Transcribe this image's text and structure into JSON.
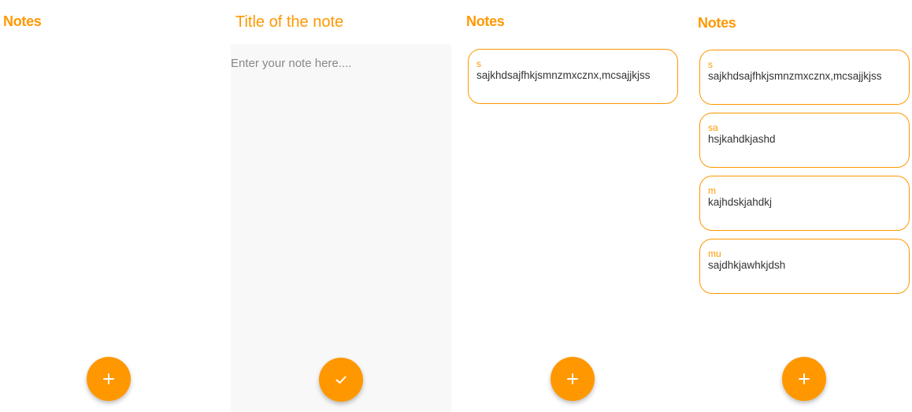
{
  "colors": {
    "accent": "#ff9800",
    "editor_bg": "#f8f8f8"
  },
  "screen1": {
    "heading": "Notes",
    "fab_icon": "plus-icon"
  },
  "screen2": {
    "title_placeholder": "Title of the note",
    "body_placeholder": "Enter your note here....",
    "fab_icon": "check-icon"
  },
  "screen3": {
    "heading": "Notes",
    "notes": [
      {
        "title": "s",
        "text": "sajkhdsajfhkjsmnzmxcznx,mcsajjkjss"
      }
    ],
    "fab_icon": "plus-icon"
  },
  "screen4": {
    "heading": "Notes",
    "notes": [
      {
        "title": "s",
        "text": "sajkhdsajfhkjsmnzmxcznx,mcsajjkjss"
      },
      {
        "title": "sa",
        "text": "hsjkahdkjashd"
      },
      {
        "title": "m",
        "text": "kajhdskjahdkj"
      },
      {
        "title": "mu",
        "text": "sajdhkjawhkjdsh"
      }
    ],
    "fab_icon": "plus-icon"
  }
}
